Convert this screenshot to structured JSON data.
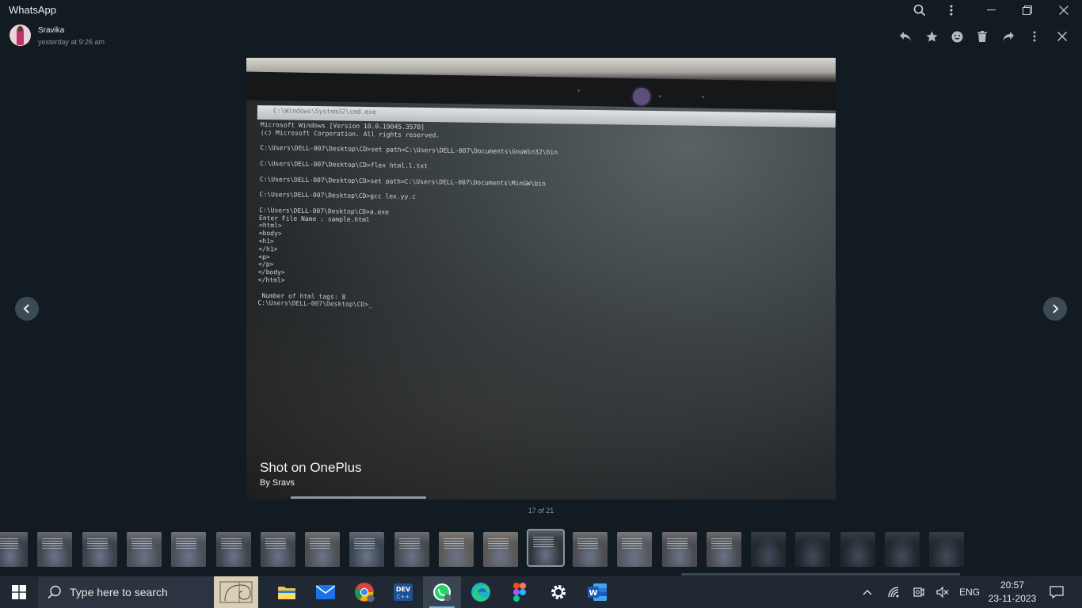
{
  "app": {
    "title": "WhatsApp"
  },
  "window_controls": {
    "search_icon": "search-icon",
    "menu_icon": "more-vertical-icon",
    "minimize_icon": "minimize-icon",
    "restore_icon": "restore-icon",
    "close_icon": "close-icon"
  },
  "sender": {
    "name": "Sravika",
    "time": "yesterday at 9:26 am"
  },
  "actions": [
    "reply-icon",
    "star-icon",
    "emoji-icon",
    "delete-icon",
    "forward-icon",
    "more-vertical-icon",
    "close-icon"
  ],
  "photo": {
    "cmd_title": "C:\\Windows\\System32\\cmd.exe",
    "terminal_lines": [
      "Microsoft Windows [Version 10.0.19045.3570]",
      "(c) Microsoft Corporation. All rights reserved.",
      "",
      "C:\\Users\\DELL-007\\Desktop\\CD>set path=C:\\Users\\DELL-007\\Documents\\GnuWin32\\bin",
      "",
      "C:\\Users\\DELL-007\\Desktop\\CD>flex html.l.txt",
      "",
      "C:\\Users\\DELL-007\\Desktop\\CD>set path=C:\\Users\\DELL-007\\Documents\\MinGW\\bin",
      "",
      "C:\\Users\\DELL-007\\Desktop\\CD>gcc lex.yy.c",
      "",
      "C:\\Users\\DELL-007\\Desktop\\CD>a.exe",
      "Enter File Name : sample.html",
      "<html>",
      "<body>",
      "<h1>",
      "</h1>",
      "<p>",
      "</p>",
      "</body>",
      "</html>",
      "",
      " Number of html tags: 8",
      "C:\\Users\\DELL-007\\Desktop\\CD>_"
    ],
    "watermark_title": "Shot on OnePlus",
    "watermark_by": "By Sravs",
    "video_progress": 0.23
  },
  "navigation": {
    "prev_icon": "chevron-left-icon",
    "next_icon": "chevron-right-icon"
  },
  "counter": "17 of 21",
  "thumbnails": {
    "selected_index": 12,
    "items": [
      {
        "tone": "#3a3f46"
      },
      {
        "tone": "#41464c"
      },
      {
        "tone": "#3d434a"
      },
      {
        "tone": "#4a4e55"
      },
      {
        "tone": "#4b4f58"
      },
      {
        "tone": "#3f444a"
      },
      {
        "tone": "#42474e"
      },
      {
        "tone": "#4d4f53"
      },
      {
        "tone": "#3b4552"
      },
      {
        "tone": "#45494f"
      },
      {
        "tone": "#5b5a57"
      },
      {
        "tone": "#5a5856"
      },
      {
        "tone": "#2f353b"
      },
      {
        "tone": "#4c4d52"
      },
      {
        "tone": "#55575b"
      },
      {
        "tone": "#4a4c50"
      },
      {
        "tone": "#47494d"
      },
      {
        "tone": "#30363b"
      },
      {
        "tone": "#2a3035"
      },
      {
        "tone": "#2c3136"
      },
      {
        "tone": "#2d3237"
      },
      {
        "tone": "#2e3338"
      }
    ]
  },
  "taskbar": {
    "search_placeholder": "Type here to search",
    "apps": [
      "cortana-icon",
      "file-explorer-icon",
      "mail-icon",
      "chrome-icon",
      "devcpp-icon",
      "whatsapp-icon",
      "edge-icon",
      "figma-icon",
      "settings-icon",
      "word-icon"
    ],
    "tray": {
      "language": "ENG",
      "time": "20:57",
      "date": "23-11-2023"
    }
  }
}
